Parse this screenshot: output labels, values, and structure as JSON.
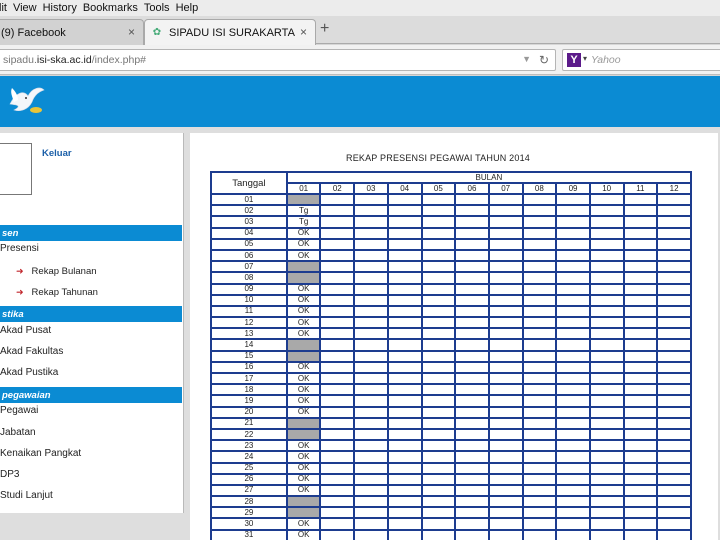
{
  "menubar": [
    "lit",
    "View",
    "History",
    "Bookmarks",
    "Tools",
    "Help"
  ],
  "tabs": [
    {
      "label": "(9) Facebook",
      "close": "×"
    },
    {
      "label": "SIPADU ISI SURAKARTA",
      "close": "×"
    }
  ],
  "newtab": "+",
  "url": {
    "host_pre": "sipadu.",
    "host_bold": "isi-ska.ac.id",
    "path": "/index.php#"
  },
  "search": {
    "placeholder": "Yahoo",
    "engine_logo": "Y"
  },
  "colors": {
    "accent": "#0b8bd3",
    "grid": "#1d3c8f",
    "holiday": "#a9a9a9"
  },
  "sidebar": {
    "logout": "Keluar",
    "sections": [
      {
        "title": "sen",
        "items": [
          {
            "label": "Presensi",
            "sub": [
              "Rekap Bulanan",
              "Rekap Tahunan"
            ]
          }
        ]
      },
      {
        "title": "stika",
        "items": [
          {
            "label": "Akad Pusat"
          },
          {
            "label": "Akad Fakultas"
          },
          {
            "label": "Akad Pustika"
          }
        ]
      },
      {
        "title": "pegawaian",
        "items": [
          {
            "label": "Pegawai"
          },
          {
            "label": "Jabatan"
          },
          {
            "label": "Kenaikan Pangkat"
          },
          {
            "label": "DP3"
          },
          {
            "label": "Studi Lanjut"
          }
        ]
      }
    ]
  },
  "report": {
    "title": "REKAP PRESENSI PEGAWAI TAHUN 2014",
    "col_tanggal": "Tanggal",
    "col_bulan": "BULAN",
    "months": [
      "01",
      "02",
      "03",
      "04",
      "05",
      "06",
      "07",
      "08",
      "09",
      "10",
      "11",
      "12"
    ],
    "rows": [
      {
        "day": "01",
        "jan": "",
        "holiday": true
      },
      {
        "day": "02",
        "jan": "Tg",
        "holiday": false
      },
      {
        "day": "03",
        "jan": "Tg",
        "holiday": false
      },
      {
        "day": "04",
        "jan": "OK",
        "holiday": false
      },
      {
        "day": "05",
        "jan": "OK",
        "holiday": false
      },
      {
        "day": "06",
        "jan": "OK",
        "holiday": false
      },
      {
        "day": "07",
        "jan": "",
        "holiday": true
      },
      {
        "day": "08",
        "jan": "",
        "holiday": true
      },
      {
        "day": "09",
        "jan": "OK",
        "holiday": false
      },
      {
        "day": "10",
        "jan": "OK",
        "holiday": false
      },
      {
        "day": "11",
        "jan": "OK",
        "holiday": false
      },
      {
        "day": "12",
        "jan": "OK",
        "holiday": false
      },
      {
        "day": "13",
        "jan": "OK",
        "holiday": false
      },
      {
        "day": "14",
        "jan": "",
        "holiday": true
      },
      {
        "day": "15",
        "jan": "",
        "holiday": true
      },
      {
        "day": "16",
        "jan": "OK",
        "holiday": false
      },
      {
        "day": "17",
        "jan": "OK",
        "holiday": false
      },
      {
        "day": "18",
        "jan": "OK",
        "holiday": false
      },
      {
        "day": "19",
        "jan": "OK",
        "holiday": false
      },
      {
        "day": "20",
        "jan": "OK",
        "holiday": false
      },
      {
        "day": "21",
        "jan": "",
        "holiday": true
      },
      {
        "day": "22",
        "jan": "",
        "holiday": true
      },
      {
        "day": "23",
        "jan": "OK",
        "holiday": false
      },
      {
        "day": "24",
        "jan": "OK",
        "holiday": false
      },
      {
        "day": "25",
        "jan": "OK",
        "holiday": false
      },
      {
        "day": "26",
        "jan": "OK",
        "holiday": false
      },
      {
        "day": "27",
        "jan": "OK",
        "holiday": false
      },
      {
        "day": "28",
        "jan": "",
        "holiday": true
      },
      {
        "day": "29",
        "jan": "",
        "holiday": true
      },
      {
        "day": "30",
        "jan": "OK",
        "holiday": false
      },
      {
        "day": "31",
        "jan": "OK",
        "holiday": false
      }
    ]
  }
}
